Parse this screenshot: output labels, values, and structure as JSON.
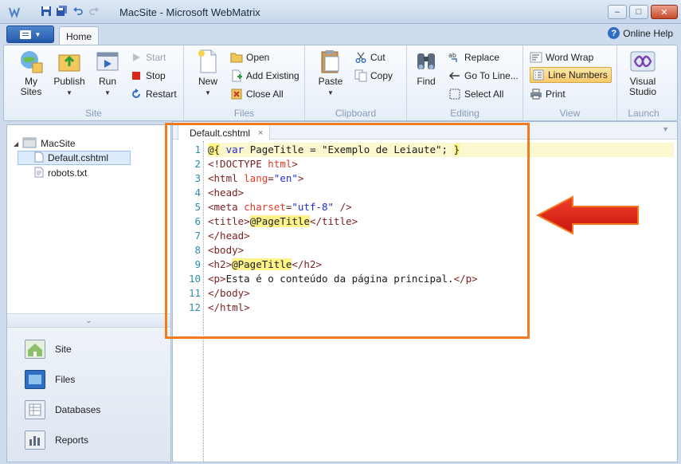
{
  "window": {
    "title": "MacSite - Microsoft WebMatrix",
    "controls": [
      "–",
      "□",
      "✕"
    ]
  },
  "tabs": {
    "home_label": "Home",
    "help_label": "Online Help"
  },
  "ribbon": {
    "site": {
      "group_label": "Site",
      "my_sites_label": "My Sites",
      "publish_label": "Publish",
      "run_label": "Run",
      "start_label": "Start",
      "stop_label": "Stop",
      "restart_label": "Restart"
    },
    "files": {
      "group_label": "Files",
      "new_label": "New",
      "open_label": "Open",
      "add_existing_label": "Add Existing",
      "close_all_label": "Close All"
    },
    "clipboard": {
      "group_label": "Clipboard",
      "paste_label": "Paste",
      "cut_label": "Cut",
      "copy_label": "Copy"
    },
    "editing": {
      "group_label": "Editing",
      "find_label": "Find",
      "replace_label": "Replace",
      "goto_label": "Go To Line...",
      "select_all_label": "Select All"
    },
    "view": {
      "group_label": "View",
      "word_wrap_label": "Word Wrap",
      "line_numbers_label": "Line Numbers",
      "print_label": "Print"
    },
    "launch": {
      "group_label": "Launch",
      "visual_studio_label": "Visual Studio"
    }
  },
  "tree": {
    "root": "MacSite",
    "files": [
      "Default.cshtml",
      "robots.txt"
    ]
  },
  "workspace": {
    "site_label": "Site",
    "files_label": "Files",
    "databases_label": "Databases",
    "reports_label": "Reports"
  },
  "editor": {
    "tab_label": "Default.cshtml",
    "tab_close": "×",
    "line_numbers": [
      "1",
      "2",
      "3",
      "4",
      "5",
      "6",
      "7",
      "8",
      "9",
      "10",
      "11",
      "12"
    ]
  },
  "accent_colors": {
    "annotation": "#f47a1f",
    "arrow": "#e8271a"
  }
}
